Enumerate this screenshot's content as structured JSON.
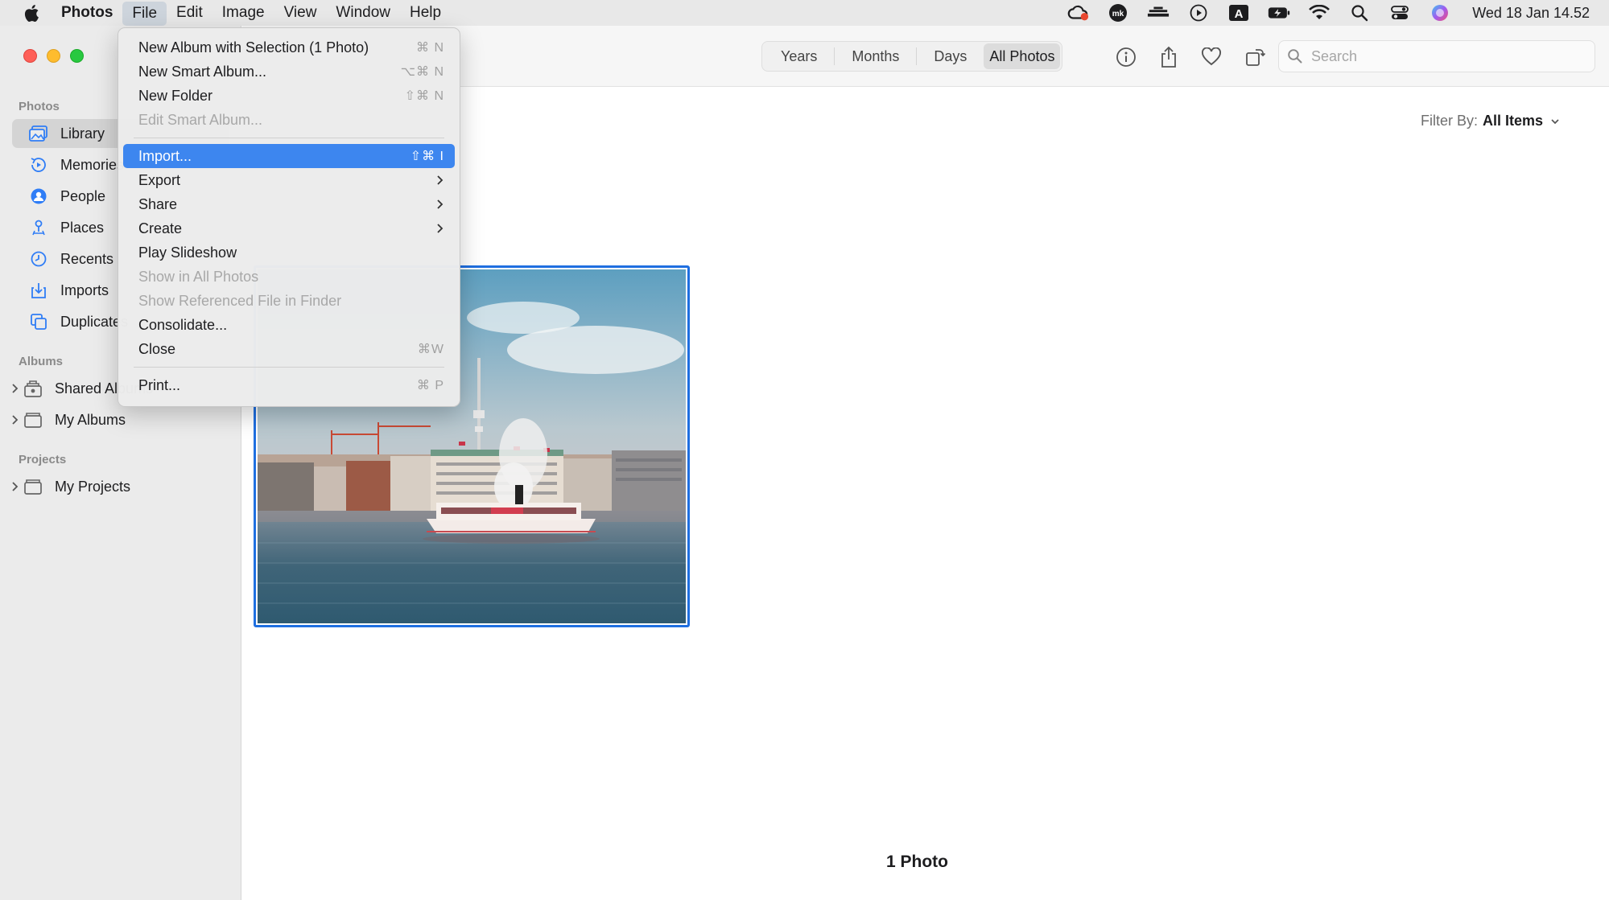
{
  "menubar": {
    "app_name": "Photos",
    "menus": [
      "File",
      "Edit",
      "Image",
      "View",
      "Window",
      "Help"
    ],
    "active_menu": "File",
    "status_icons": [
      "creative-cloud-icon",
      "mk-app-icon",
      "bartender-icon",
      "play-circle-icon",
      "keyboard-input-a-icon",
      "battery-charging-icon",
      "wifi-icon",
      "spotlight-search-icon",
      "control-center-icon",
      "siri-icon"
    ],
    "input_source_letter": "A",
    "mk_label": "mk",
    "clock": "Wed 18 Jan  14.52"
  },
  "sidebar": {
    "sections": {
      "photos": "Photos",
      "albums": "Albums",
      "projects": "Projects"
    },
    "items": [
      {
        "label": "Library",
        "icon": "library-icon",
        "selected": true
      },
      {
        "label": "Memories",
        "icon": "memories-icon"
      },
      {
        "label": "People",
        "icon": "people-icon"
      },
      {
        "label": "Places",
        "icon": "places-icon"
      },
      {
        "label": "Recents",
        "icon": "recents-icon"
      },
      {
        "label": "Imports",
        "icon": "imports-icon"
      },
      {
        "label": "Duplicates",
        "icon": "duplicates-icon"
      }
    ],
    "album_items": [
      {
        "label": "Shared Albums",
        "icon": "shared-albums-icon"
      },
      {
        "label": "My Albums",
        "icon": "folder-icon"
      }
    ],
    "project_items": [
      {
        "label": "My Projects",
        "icon": "folder-icon"
      }
    ]
  },
  "toolbar": {
    "segments": [
      "Years",
      "Months",
      "Days",
      "All Photos"
    ],
    "active_segment": "All Photos",
    "search_placeholder": "Search"
  },
  "content": {
    "filter_label": "Filter By:",
    "filter_value": "All Items",
    "photo_count": "1 Photo"
  },
  "file_menu": {
    "items": [
      {
        "label": "New Album with Selection (1 Photo)",
        "shortcut": "⌘ N"
      },
      {
        "label": "New Smart Album...",
        "shortcut": "⌥⌘ N"
      },
      {
        "label": "New Folder",
        "shortcut": "⇧⌘ N"
      },
      {
        "label": "Edit Smart Album...",
        "shortcut": "",
        "disabled": true
      },
      {
        "label": "Import...",
        "shortcut": "⇧⌘  I",
        "highlighted": true
      },
      {
        "label": "Export",
        "submenu": true
      },
      {
        "label": "Share",
        "submenu": true
      },
      {
        "label": "Create",
        "submenu": true
      },
      {
        "label": "Play Slideshow",
        "shortcut": ""
      },
      {
        "label": "Show in All Photos",
        "disabled": true
      },
      {
        "label": "Show Referenced File in Finder",
        "disabled": true
      },
      {
        "label": "Consolidate...",
        "shortcut": ""
      },
      {
        "label": "Close",
        "shortcut": "⌘W"
      },
      {
        "label": "Print...",
        "shortcut": "⌘ P"
      }
    ]
  },
  "colors": {
    "accent": "#3d86ef",
    "selection_border": "#1f6fe0"
  }
}
